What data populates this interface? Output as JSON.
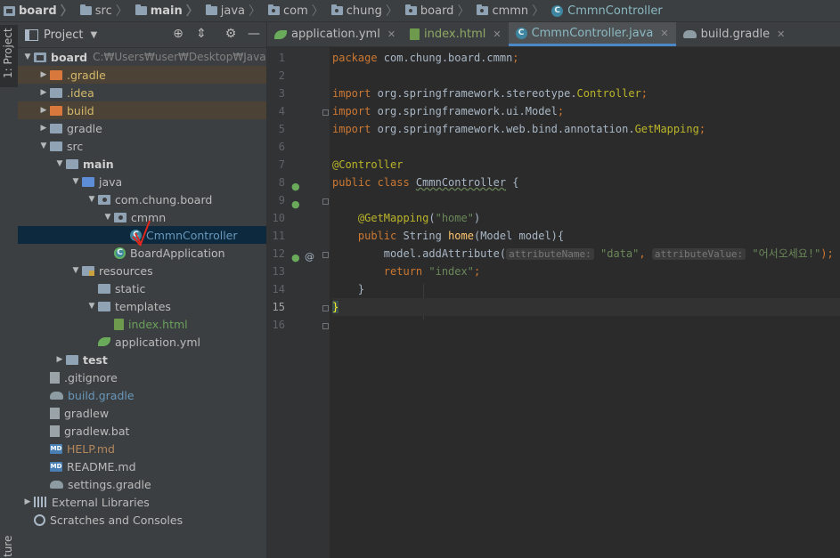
{
  "breadcrumb": [
    {
      "label": "board",
      "bold": true,
      "icon": "module-icon"
    },
    {
      "label": "src",
      "icon": "folder-icon"
    },
    {
      "label": "main",
      "bold": true,
      "icon": "folder-icon"
    },
    {
      "label": "java",
      "icon": "folder-icon"
    },
    {
      "label": "com",
      "icon": "package-icon"
    },
    {
      "label": "chung",
      "icon": "package-icon"
    },
    {
      "label": "board",
      "icon": "package-icon"
    },
    {
      "label": "cmmn",
      "icon": "package-icon"
    },
    {
      "label": "CmmnController",
      "icon": "class-icon"
    }
  ],
  "side": {
    "project_tab": "1: Project",
    "bottom_tab": "ture"
  },
  "project_panel": {
    "title": "Project"
  },
  "tree": [
    {
      "label": "board",
      "path": "C:₩Users₩user₩Desktop₩Java₩board",
      "icon": "module",
      "arrow": "down",
      "indent": 0,
      "style": "bold"
    },
    {
      "label": ".gradle",
      "icon": "folder-orange",
      "arrow": "right",
      "indent": 1,
      "style": "orange",
      "hl": "orange"
    },
    {
      "label": ".idea",
      "icon": "folder",
      "arrow": "right",
      "indent": 1,
      "style": "orange"
    },
    {
      "label": "build",
      "icon": "folder-orange",
      "arrow": "right",
      "indent": 1,
      "style": "orange",
      "hl": "orange"
    },
    {
      "label": "gradle",
      "icon": "folder",
      "arrow": "right",
      "indent": 1
    },
    {
      "label": "src",
      "icon": "folder",
      "arrow": "down",
      "indent": 1
    },
    {
      "label": "main",
      "icon": "folder",
      "arrow": "down",
      "indent": 2,
      "style": "bold"
    },
    {
      "label": "java",
      "icon": "folder-src",
      "arrow": "down",
      "indent": 3
    },
    {
      "label": "com.chung.board",
      "icon": "folder-pkg",
      "arrow": "down",
      "indent": 4
    },
    {
      "label": "cmmn",
      "icon": "folder-pkg",
      "arrow": "down",
      "indent": 5
    },
    {
      "label": "CmmnController",
      "icon": "class",
      "arrow": "none",
      "indent": 6,
      "style": "blue",
      "selected": true
    },
    {
      "label": "BoardApplication",
      "icon": "class-spring",
      "arrow": "none",
      "indent": 5
    },
    {
      "label": "resources",
      "icon": "folder-res",
      "arrow": "down",
      "indent": 3
    },
    {
      "label": "static",
      "icon": "folder",
      "arrow": "none",
      "indent": 4
    },
    {
      "label": "templates",
      "icon": "folder",
      "arrow": "down",
      "indent": 4
    },
    {
      "label": "index.html",
      "icon": "file-html",
      "arrow": "none",
      "indent": 5,
      "style": "green"
    },
    {
      "label": "application.yml",
      "icon": "leaf",
      "arrow": "none",
      "indent": 4
    },
    {
      "label": "test",
      "icon": "folder",
      "arrow": "right",
      "indent": 2,
      "style": "bold"
    },
    {
      "label": ".gitignore",
      "icon": "txt",
      "arrow": "none",
      "indent": 1
    },
    {
      "label": "build.gradle",
      "icon": "gradle",
      "arrow": "none",
      "indent": 1,
      "style": "blue"
    },
    {
      "label": "gradlew",
      "icon": "txt",
      "arrow": "none",
      "indent": 1
    },
    {
      "label": "gradlew.bat",
      "icon": "txt",
      "arrow": "none",
      "indent": 1
    },
    {
      "label": "HELP.md",
      "icon": "md",
      "arrow": "none",
      "indent": 1,
      "style": "brown"
    },
    {
      "label": "README.md",
      "icon": "md",
      "arrow": "none",
      "indent": 1
    },
    {
      "label": "settings.gradle",
      "icon": "gradle",
      "arrow": "none",
      "indent": 1
    },
    {
      "label": "External Libraries",
      "icon": "libs",
      "arrow": "right",
      "indent": 0
    },
    {
      "label": "Scratches and Consoles",
      "icon": "scratch",
      "arrow": "none",
      "indent": 0
    }
  ],
  "tabs": [
    {
      "label": "application.yml",
      "icon": "leaf-icon",
      "kind": "yml"
    },
    {
      "label": "index.html",
      "icon": "html-file-icon",
      "kind": "html"
    },
    {
      "label": "CmmnController.java",
      "icon": "class-icon",
      "kind": "java",
      "active": true
    },
    {
      "label": "build.gradle",
      "icon": "gradle-icon",
      "kind": "gradle"
    }
  ],
  "editor": {
    "current_line": 15,
    "lines": [
      {
        "n": "1",
        "tokens": [
          {
            "t": "package ",
            "c": "kw"
          },
          {
            "t": "com.chung.board.cmmn",
            "c": "plain"
          },
          {
            "t": ";",
            "c": "kw"
          }
        ]
      },
      {
        "n": "2",
        "tokens": []
      },
      {
        "n": "3",
        "tokens": [
          {
            "t": "import ",
            "c": "kw"
          },
          {
            "t": "org.springframework.stereotype.",
            "c": "plain"
          },
          {
            "t": "Controller",
            "c": "ann"
          },
          {
            "t": ";",
            "c": "kw"
          }
        ]
      },
      {
        "n": "4",
        "tokens": [
          {
            "t": "import ",
            "c": "kw"
          },
          {
            "t": "org.springframework.ui.Model",
            "c": "plain"
          },
          {
            "t": ";",
            "c": "kw"
          }
        ]
      },
      {
        "n": "5",
        "tokens": [
          {
            "t": "import ",
            "c": "kw"
          },
          {
            "t": "org.springframework.web.bind.annotation.",
            "c": "plain"
          },
          {
            "t": "GetMapping",
            "c": "ann"
          },
          {
            "t": ";",
            "c": "kw"
          }
        ]
      },
      {
        "n": "6",
        "tokens": []
      },
      {
        "n": "7",
        "tokens": [
          {
            "t": "@Controller",
            "c": "ann"
          }
        ]
      },
      {
        "n": "8",
        "tokens": [
          {
            "t": "public class ",
            "c": "kw"
          },
          {
            "t": "CmmnController",
            "c": "plain wavy"
          },
          {
            "t": " {",
            "c": "plain"
          }
        ]
      },
      {
        "n": "9",
        "tokens": []
      },
      {
        "n": "10",
        "tokens": [
          {
            "t": "    @GetMapping",
            "c": "ann"
          },
          {
            "t": "(",
            "c": "plain"
          },
          {
            "t": "\"home\"",
            "c": "str"
          },
          {
            "t": ")",
            "c": "plain"
          }
        ]
      },
      {
        "n": "11",
        "tokens": [
          {
            "t": "    public ",
            "c": "kw"
          },
          {
            "t": "String ",
            "c": "plain"
          },
          {
            "t": "home",
            "c": "fn"
          },
          {
            "t": "(Model model){",
            "c": "plain"
          }
        ]
      },
      {
        "n": "12",
        "tokens": [
          {
            "t": "        model.addAttribute(",
            "c": "plain"
          },
          {
            "t": "attributeName:",
            "c": "hint"
          },
          {
            "t": " ",
            "c": "plain"
          },
          {
            "t": "\"data\"",
            "c": "str"
          },
          {
            "t": ", ",
            "c": "kw"
          },
          {
            "t": "attributeValue:",
            "c": "hint"
          },
          {
            "t": " ",
            "c": "plain"
          },
          {
            "t": "\"어서오세요!\"",
            "c": "str"
          },
          {
            "t": ");",
            "c": "kw"
          }
        ]
      },
      {
        "n": "13",
        "tokens": [
          {
            "t": "        return ",
            "c": "kw"
          },
          {
            "t": "\"index\"",
            "c": "str"
          },
          {
            "t": ";",
            "c": "kw"
          }
        ]
      },
      {
        "n": "14",
        "tokens": [
          {
            "t": "    }",
            "c": "plain"
          }
        ]
      },
      {
        "n": "15",
        "tokens": [
          {
            "t": "}",
            "c": "brace-hl"
          }
        ]
      },
      {
        "n": "16",
        "tokens": []
      }
    ]
  },
  "colors": {
    "accent": "#4a88c7",
    "selection": "#0d293e",
    "ignored_bg": "#4d4236"
  }
}
